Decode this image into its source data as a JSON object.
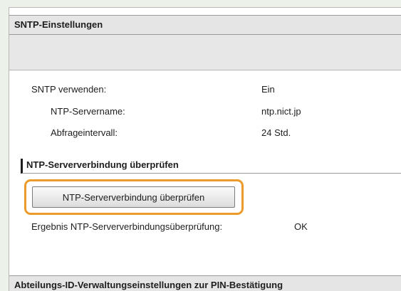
{
  "sntp_section": {
    "title": "SNTP-Einstellungen"
  },
  "settings": {
    "use_sntp": {
      "label": "SNTP verwenden:",
      "value": "Ein"
    },
    "server_name": {
      "label": "NTP-Servername:",
      "value": "ntp.nict.jp"
    },
    "poll_interval": {
      "label": "Abfrageintervall:",
      "value": "24 Std."
    }
  },
  "connection_check": {
    "title": "NTP-Serververbindung überprüfen",
    "button_label": "NTP-Serververbindung überprüfen",
    "result_label": "Ergebnis NTP-Serververbindungsüberprüfung:",
    "result_value": "OK"
  },
  "next_section": {
    "title": "Abteilungs-ID-Verwaltungseinstellungen zur PIN-Bestätigung"
  },
  "colors": {
    "highlight_ring": "#ec9a29",
    "section_header_bg": "#e5e5e5",
    "page_bg": "#ecf1ea"
  }
}
